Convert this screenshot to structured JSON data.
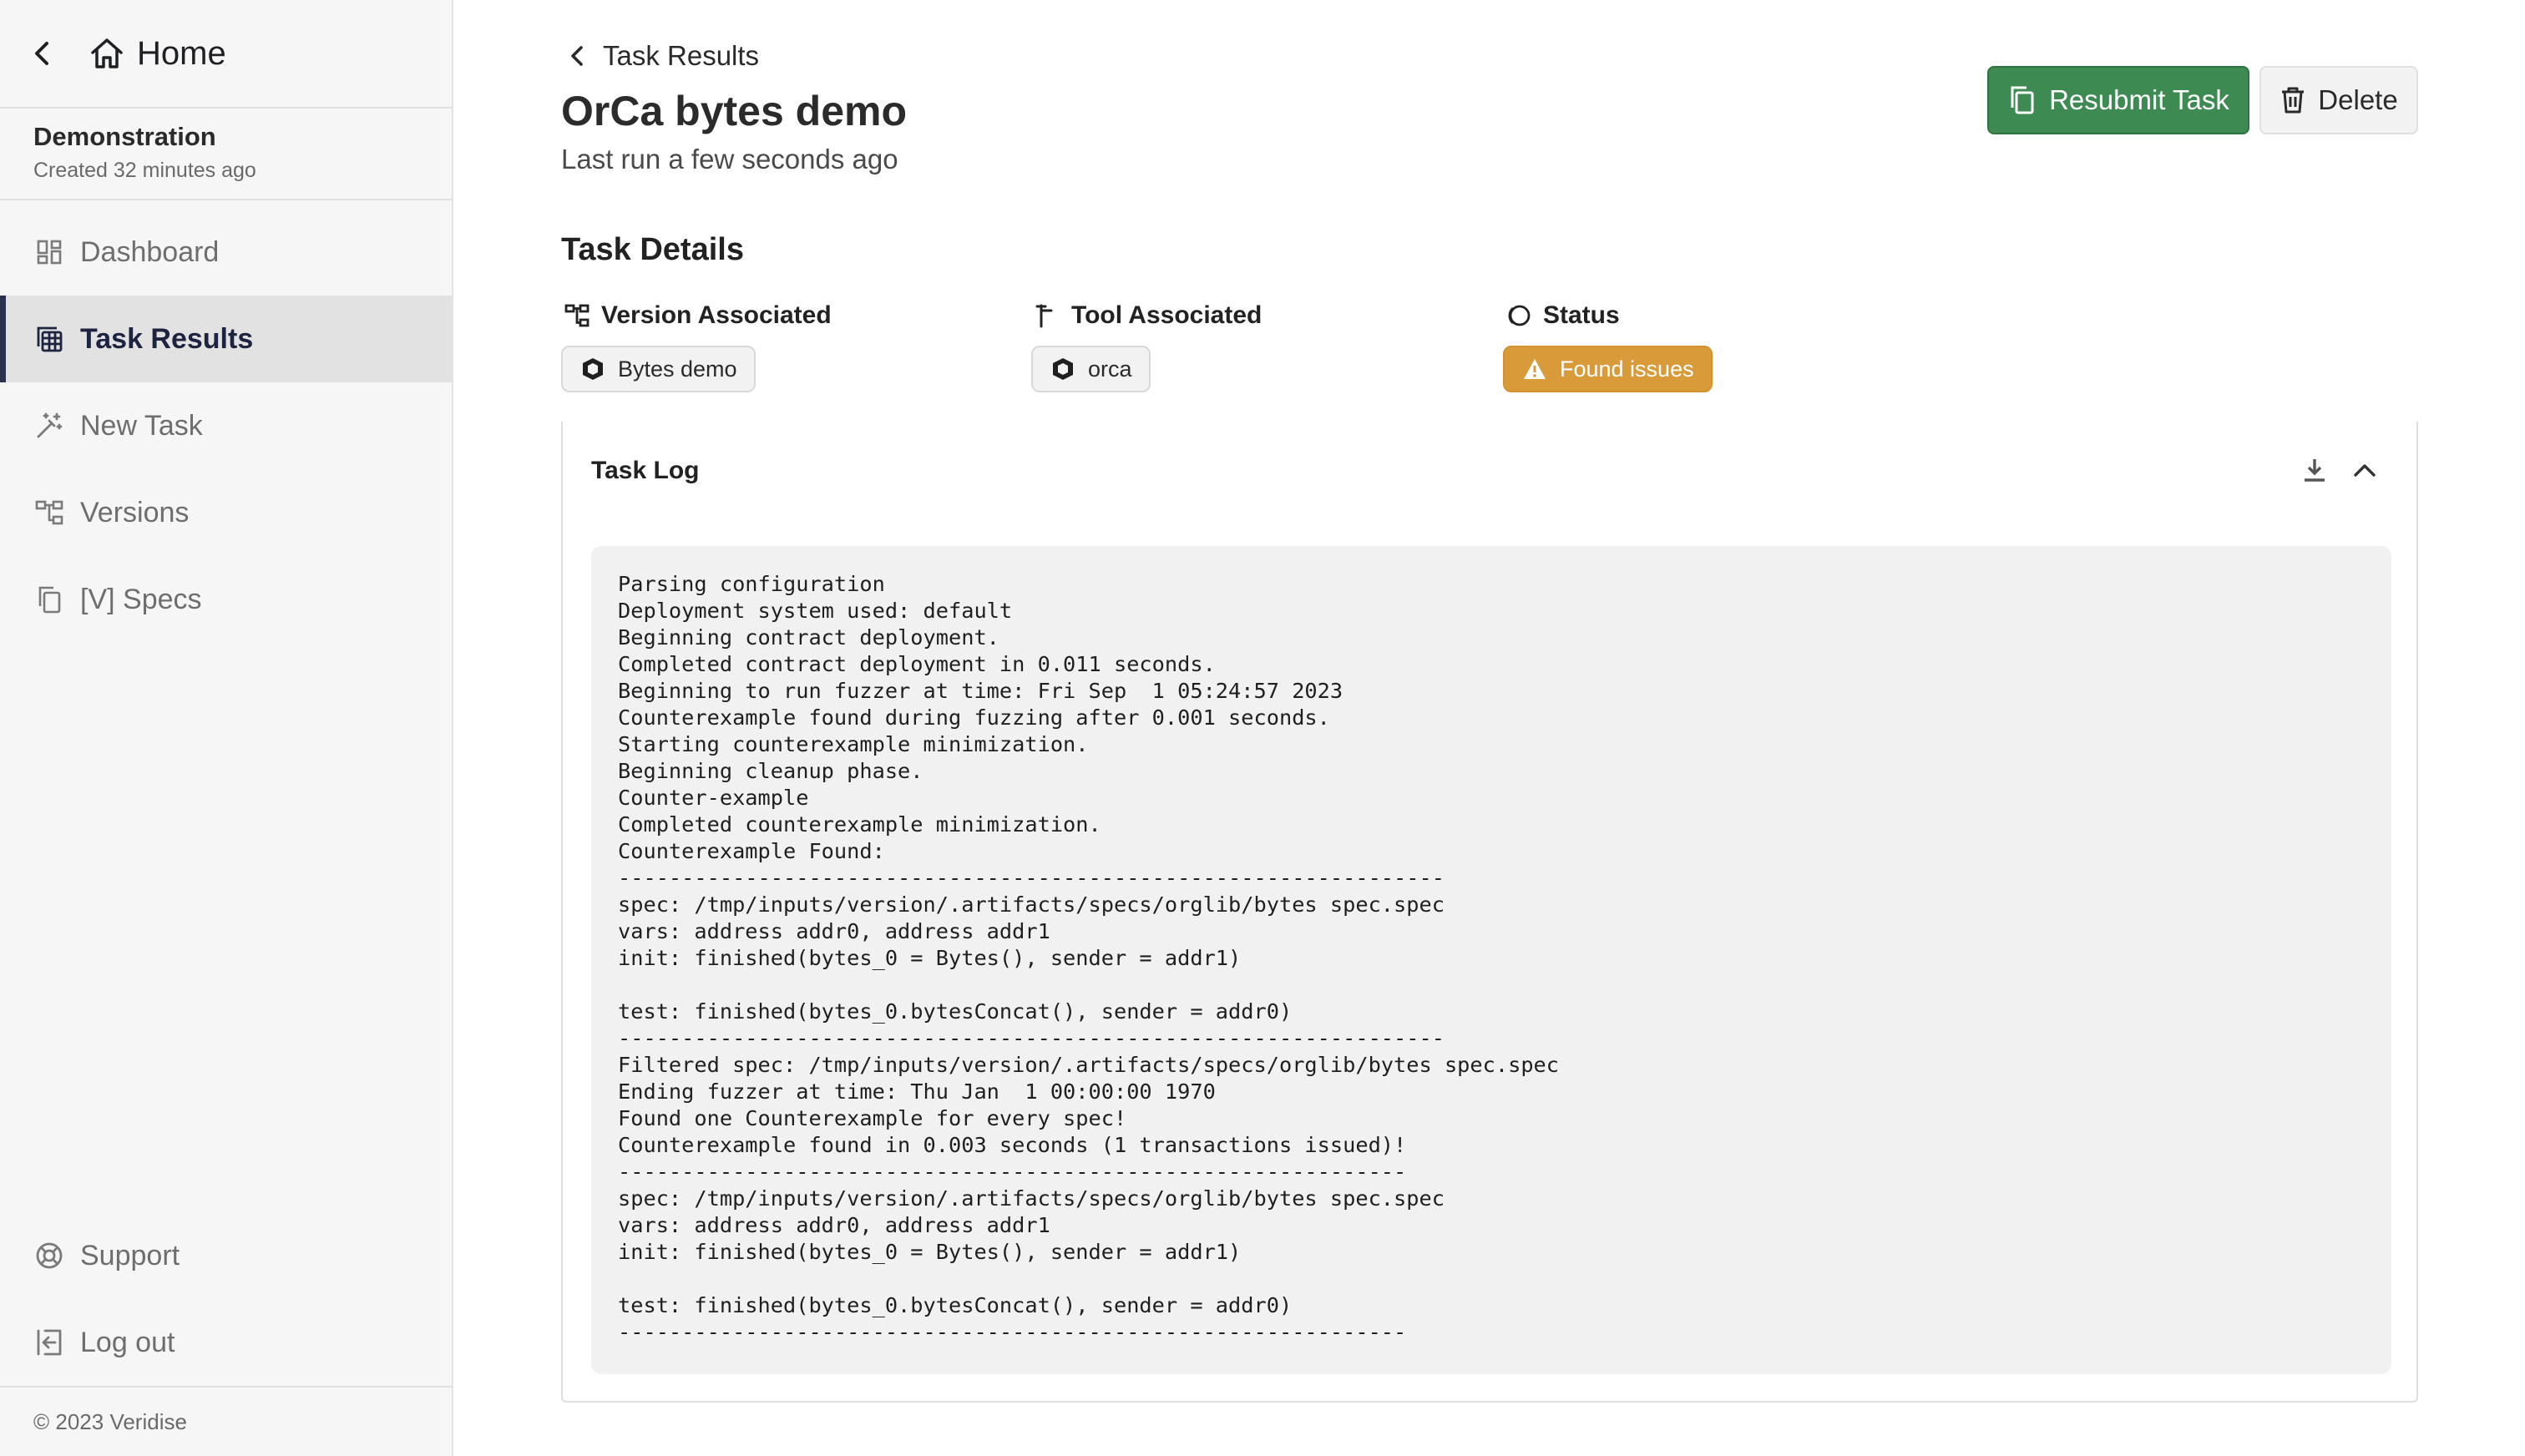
{
  "sidebar": {
    "home_label": "Home",
    "project_name": "Demonstration",
    "project_created": "Created 32 minutes ago",
    "items": [
      {
        "label": "Dashboard",
        "icon": "dashboard-icon"
      },
      {
        "label": "Task Results",
        "icon": "table-icon",
        "active": true
      },
      {
        "label": "New Task",
        "icon": "magic-wand-icon"
      },
      {
        "label": "Versions",
        "icon": "hierarchy-icon"
      },
      {
        "label": "[V] Specs",
        "icon": "copy-icon"
      }
    ],
    "bottom_items": [
      {
        "label": "Support",
        "icon": "lifebuoy-icon"
      },
      {
        "label": "Log out",
        "icon": "logout-icon"
      }
    ],
    "footer": "© 2023 Veridise"
  },
  "main": {
    "breadcrumb": "Task Results",
    "title": "OrCa bytes demo",
    "subtitle": "Last run a few seconds ago",
    "resubmit_label": "Resubmit Task",
    "delete_label": "Delete",
    "section_title": "Task Details",
    "details": {
      "version_heading": "Version Associated",
      "version_value": "Bytes demo",
      "tool_heading": "Tool Associated",
      "tool_value": "orca",
      "status_heading": "Status",
      "status_value": "Found issues"
    },
    "accent_colors": {
      "resubmit": "#3d8a52",
      "status_warning": "#d99a3a",
      "active_nav": "#2a3250"
    }
  },
  "log": {
    "title": "Task Log",
    "lines": [
      "Parsing configuration",
      "Deployment system used: default",
      "Beginning contract deployment.",
      "Completed contract deployment in 0.011 seconds.",
      "Beginning to run fuzzer at time: Fri Sep  1 05:24:57 2023",
      "Counterexample found during fuzzing after 0.001 seconds.",
      "Starting counterexample minimization.",
      "Beginning cleanup phase.",
      "Counter-example",
      "Completed counterexample minimization.",
      "Counterexample Found:",
      "-----------------------------------------------------------------",
      "spec: /tmp/inputs/version/.artifacts/specs/orglib/bytes spec.spec",
      "vars: address addr0, address addr1",
      "init: finished(bytes_0 = Bytes(), sender = addr1)",
      "",
      "test: finished(bytes_0.bytesConcat(), sender = addr0)",
      "-----------------------------------------------------------------",
      "Filtered spec: /tmp/inputs/version/.artifacts/specs/orglib/bytes spec.spec",
      "Ending fuzzer at time: Thu Jan  1 00:00:00 1970",
      "Found one Counterexample for every spec!",
      "Counterexample found in 0.003 seconds (1 transactions issued)!",
      "--------------------------------------------------------------",
      "spec: /tmp/inputs/version/.artifacts/specs/orglib/bytes spec.spec",
      "vars: address addr0, address addr1",
      "init: finished(bytes_0 = Bytes(), sender = addr1)",
      "",
      "test: finished(bytes_0.bytesConcat(), sender = addr0)",
      "--------------------------------------------------------------"
    ]
  }
}
